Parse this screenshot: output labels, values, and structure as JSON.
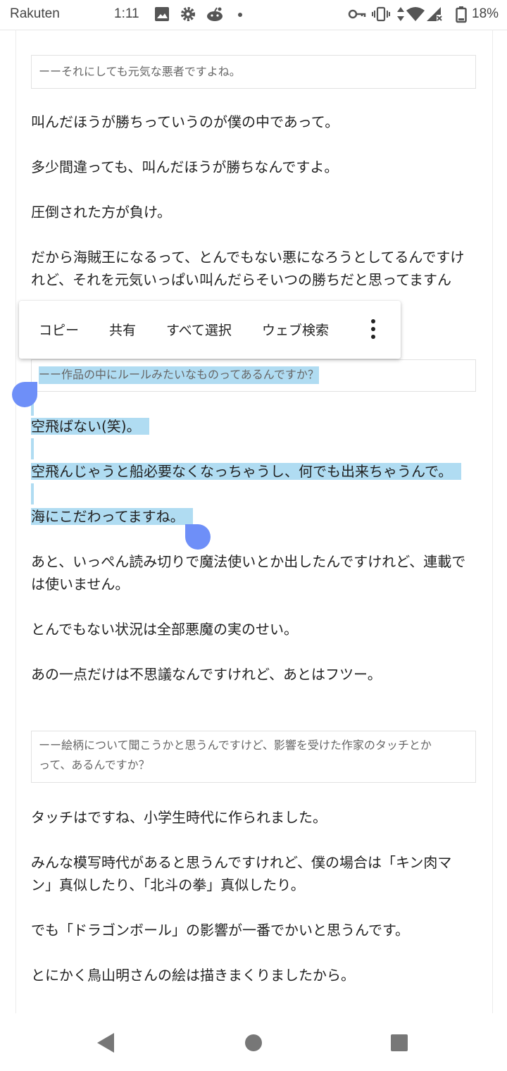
{
  "statusbar": {
    "carrier": "Rakuten",
    "time": "1:11",
    "battery": "18%"
  },
  "article": {
    "q1": "ーーそれにしても元気な悪者ですよね。",
    "p1": "叫んだほうが勝ちっていうのが僕の中であって。",
    "p2": "多少間違っても、叫んだほうが勝ちなんですよ。",
    "p3": "圧倒された方が負け。",
    "p4_line1": "だから海賊王になるって、とんでもない悪になろうとしてるんですけ",
    "p4_line2": "れど、それを元気いっぱい叫んだらそいつの勝ちだと思ってますん",
    "q2": "ーー作品の中にルールみたいなものってあるんですか？",
    "p5": "空飛ばない(笑)。",
    "p6": "空飛んじゃうと船必要なくなっちゃうし、何でも出来ちゃうんで。",
    "p7": "海にこだわってますね。",
    "p8_line1": "あと、いっぺん読み切りで魔法使いとか出したんですけれど、連載で",
    "p8_line2": "は使いません。",
    "p9": "とんでもない状況は全部悪魔の実のせい。",
    "p10": "あの一点だけは不思議なんですけれど、あとはフツー。",
    "q3_line1": "ーー絵柄について聞こうかと思うんですけど、影響を受けた作家のタッチとか",
    "q3_line2": "って、あるんですか？",
    "p11": "タッチはですね、小学生時代に作られました。",
    "p12_line1": "みんな模写時代があると思うんですけれど、僕の場合は「キン肉マ",
    "p12_line2": "ン」真似したり、「北斗の拳」真似したり。",
    "p13": "でも「ドラゴンボール」の影響が一番でかいと思うんです。",
    "p14": "とにかく鳥山明さんの絵は描きまくりましたから。"
  },
  "context_menu": {
    "copy": "コピー",
    "share": "共有",
    "select_all": "すべて選択",
    "web_search": "ウェブ検索",
    "more_icon": "more-vert-icon"
  },
  "colors": {
    "selection": "#b0dcf2",
    "handle": "#6e8ff8"
  },
  "navbar": {
    "back_icon": "back-triangle-icon",
    "home_icon": "home-circle-icon",
    "recents_icon": "recents-square-icon"
  }
}
